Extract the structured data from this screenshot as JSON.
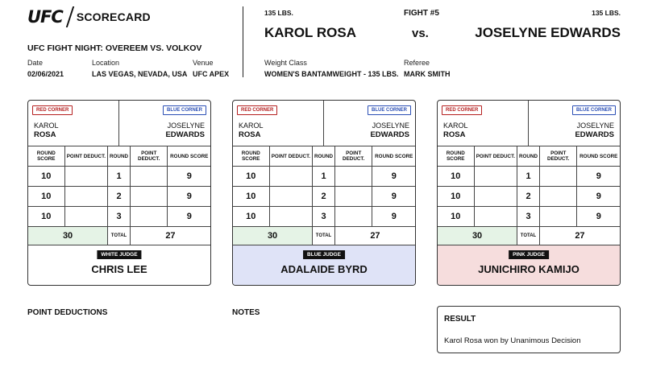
{
  "header": {
    "logo_text": "UFC",
    "doc_title": "SCORECARD",
    "event": "UFC FIGHT NIGHT: OVEREEM VS. VOLKOV",
    "date_label": "Date",
    "date": "02/06/2021",
    "location_label": "Location",
    "location": "LAS VEGAS, NEVADA, USA",
    "venue_label": "Venue",
    "venue": "UFC APEX"
  },
  "fight": {
    "weight_left": "135 LBS.",
    "weight_right": "135 LBS.",
    "number": "FIGHT #5",
    "red_fighter": "KAROL ROSA",
    "vs": "vs.",
    "blue_fighter": "JOSELYNE EDWARDS",
    "weight_class_label": "Weight Class",
    "weight_class": "WOMEN'S BANTAMWEIGHT - 135 LBS.",
    "referee_label": "Referee",
    "referee": "MARK SMITH"
  },
  "columns": {
    "round_score": "ROUND SCORE",
    "point_deduct": "POINT DEDUCT.",
    "round": "ROUND",
    "total": "TOTAL"
  },
  "corner_labels": {
    "red": "RED CORNER",
    "blue": "BLUE CORNER"
  },
  "fighter_names": {
    "red_first": "KAROL",
    "red_last": "ROSA",
    "blue_first": "JOSELYNE",
    "blue_last": "EDWARDS"
  },
  "cards": [
    {
      "rounds": [
        {
          "round": "1",
          "red_score": "10",
          "red_deduct": "",
          "blue_deduct": "",
          "blue_score": "9"
        },
        {
          "round": "2",
          "red_score": "10",
          "red_deduct": "",
          "blue_deduct": "",
          "blue_score": "9"
        },
        {
          "round": "3",
          "red_score": "10",
          "red_deduct": "",
          "blue_deduct": "",
          "blue_score": "9"
        }
      ],
      "red_total": "30",
      "blue_total": "27",
      "judge_tag": "WHITE JUDGE",
      "judge_name": "CHRIS LEE",
      "judge_color": "#ffffff"
    },
    {
      "rounds": [
        {
          "round": "1",
          "red_score": "10",
          "red_deduct": "",
          "blue_deduct": "",
          "blue_score": "9"
        },
        {
          "round": "2",
          "red_score": "10",
          "red_deduct": "",
          "blue_deduct": "",
          "blue_score": "9"
        },
        {
          "round": "3",
          "red_score": "10",
          "red_deduct": "",
          "blue_deduct": "",
          "blue_score": "9"
        }
      ],
      "red_total": "30",
      "blue_total": "27",
      "judge_tag": "BLUE JUDGE",
      "judge_name": "ADALAIDE BYRD",
      "judge_color": "#dfe3f7"
    },
    {
      "rounds": [
        {
          "round": "1",
          "red_score": "10",
          "red_deduct": "",
          "blue_deduct": "",
          "blue_score": "9"
        },
        {
          "round": "2",
          "red_score": "10",
          "red_deduct": "",
          "blue_deduct": "",
          "blue_score": "9"
        },
        {
          "round": "3",
          "red_score": "10",
          "red_deduct": "",
          "blue_deduct": "",
          "blue_score": "9"
        }
      ],
      "red_total": "30",
      "blue_total": "27",
      "judge_tag": "PINK JUDGE",
      "judge_name": "JUNICHIRO KAMIJO",
      "judge_color": "#f6dddd"
    }
  ],
  "footer": {
    "point_deductions": "POINT DEDUCTIONS",
    "notes": "NOTES",
    "result_label": "RESULT",
    "result_text": "Karol Rosa won by Unanimous Decision"
  },
  "colors": {
    "red_corner": "#b52020",
    "blue_corner": "#2b4fb5",
    "total_highlight": "#e5f3e6"
  }
}
